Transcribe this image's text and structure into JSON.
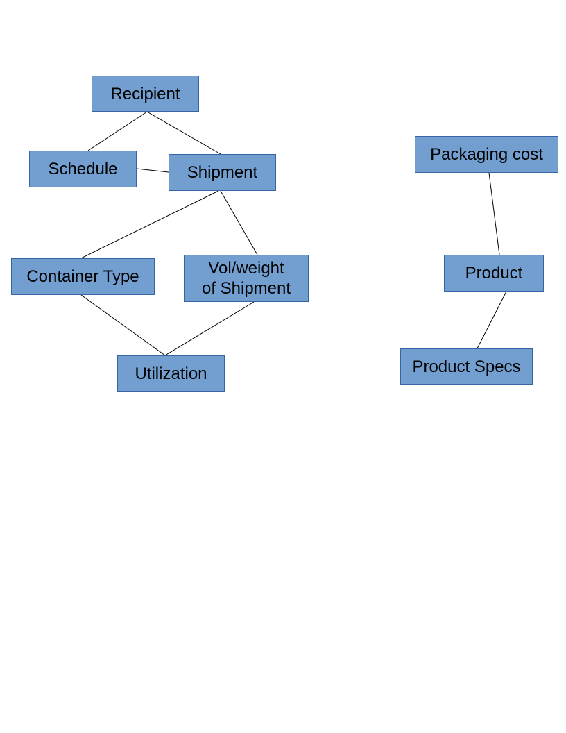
{
  "diagram": {
    "nodes": [
      {
        "id": "recipient",
        "label": "Recipient"
      },
      {
        "id": "schedule",
        "label": "Schedule"
      },
      {
        "id": "shipment",
        "label": "Shipment"
      },
      {
        "id": "container_type",
        "label": "Container Type"
      },
      {
        "id": "vol_weight",
        "label_line1": "Vol/weight",
        "label_line2": "of Shipment"
      },
      {
        "id": "utilization",
        "label": "Utilization"
      },
      {
        "id": "packaging_cost",
        "label": "Packaging cost"
      },
      {
        "id": "product",
        "label": "Product"
      },
      {
        "id": "product_specs",
        "label": "Product Specs"
      }
    ],
    "edges": [
      {
        "from": "recipient",
        "to": "schedule"
      },
      {
        "from": "recipient",
        "to": "shipment"
      },
      {
        "from": "schedule",
        "to": "shipment"
      },
      {
        "from": "shipment",
        "to": "container_type"
      },
      {
        "from": "shipment",
        "to": "vol_weight"
      },
      {
        "from": "container_type",
        "to": "utilization"
      },
      {
        "from": "vol_weight",
        "to": "utilization"
      },
      {
        "from": "packaging_cost",
        "to": "product"
      },
      {
        "from": "product",
        "to": "product_specs"
      }
    ],
    "colors": {
      "node_fill": "#729fcf",
      "node_border": "#3465a4",
      "edge": "#000000",
      "text": "#000000"
    }
  }
}
